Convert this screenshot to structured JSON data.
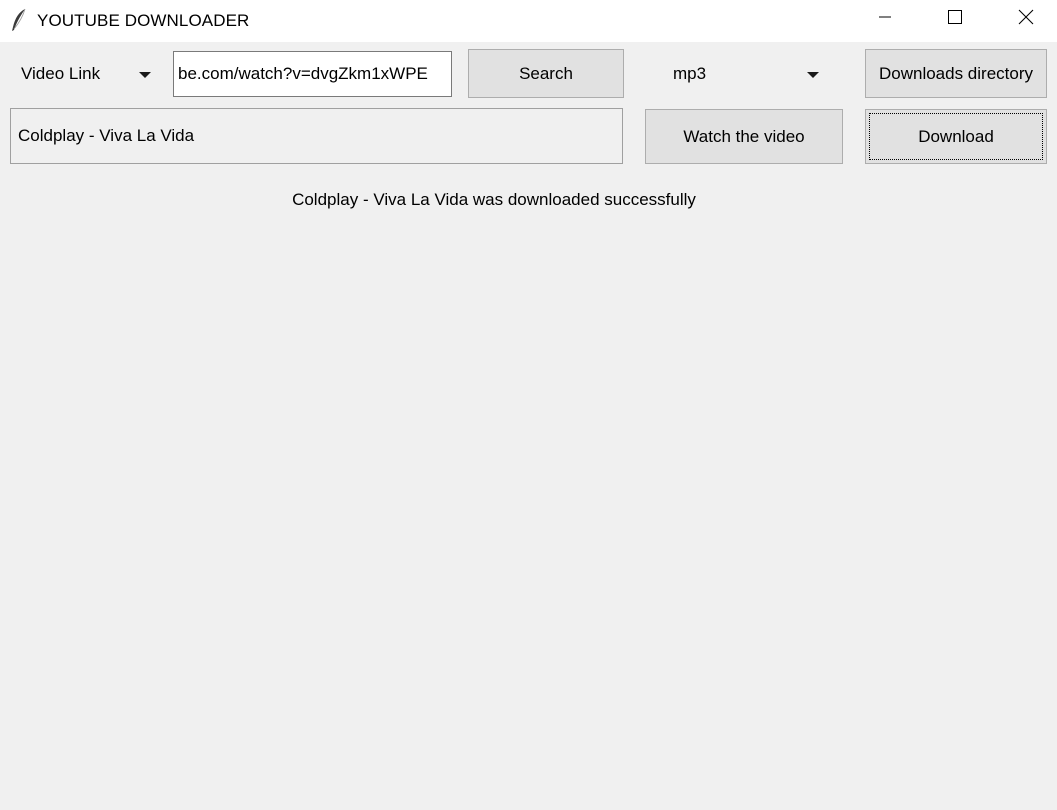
{
  "window": {
    "title": "YOUTUBE DOWNLOADER",
    "icon": "feather-icon"
  },
  "controls": {
    "source_select": {
      "selected": "Video Link"
    },
    "url_input": {
      "value": "be.com/watch?v=dvgZkm1xWPE"
    },
    "search_label": "Search",
    "format_select": {
      "selected": "mp3"
    },
    "downloads_directory_label": "Downloads directory",
    "video_title_value": "Coldplay - Viva La Vida",
    "watch_label": "Watch the video",
    "download_label": "Download"
  },
  "status": {
    "message": "Coldplay - Viva La Vida was downloaded successfully"
  },
  "colors": {
    "background": "#f0f0f0",
    "titlebar": "#ffffff",
    "button_face": "#e1e1e1",
    "button_border": "#adadad"
  }
}
